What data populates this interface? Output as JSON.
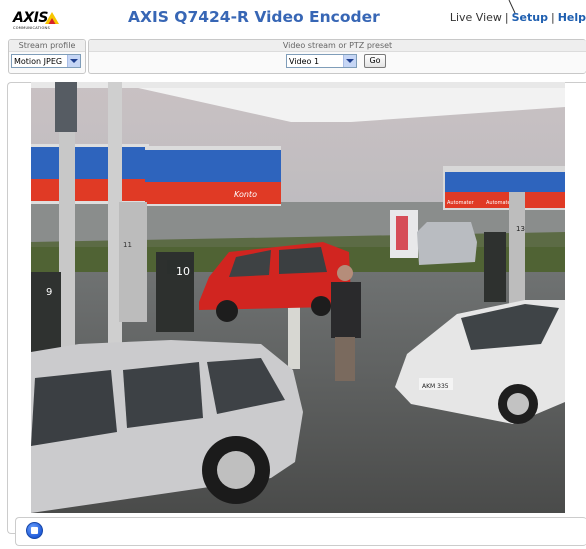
{
  "header": {
    "logo_text": "AXIS",
    "logo_subtext": "COMMUNICATIONS",
    "title": "AXIS Q7424-R Video Encoder",
    "nav": {
      "live_view": "Live View",
      "separator": "|",
      "setup": "Setup",
      "help": "Help"
    }
  },
  "stream_profile": {
    "label": "Stream profile",
    "selected": "Motion JPEG"
  },
  "preset": {
    "label": "Video stream or PTZ preset",
    "selected": "Video 1",
    "go_label": "Go"
  },
  "video": {
    "signs": {
      "canopy": "Konto",
      "right_canopy_1": "Automater",
      "right_canopy_2": "Automater",
      "pump_left": "9",
      "pump_center": "10",
      "pump_right": "13",
      "pillar": "11",
      "plate": "AKM 335"
    }
  },
  "controls": {
    "stop_icon": "stop-icon"
  },
  "colors": {
    "title_blue": "#3766b5",
    "link_blue": "#1f5fb0",
    "logo_yellow": "#f7c600",
    "logo_red": "#d8232a",
    "canopy_red": "#e03a25",
    "canopy_blue": "#2e64bd"
  }
}
